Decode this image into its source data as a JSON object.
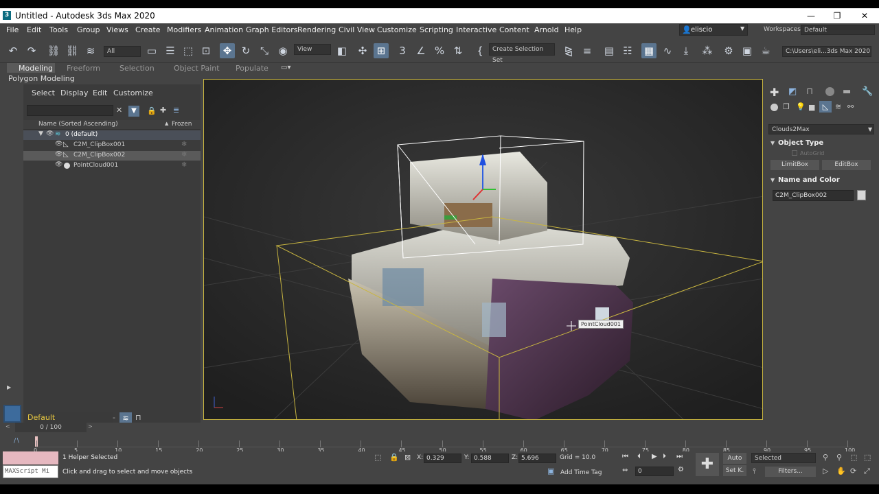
{
  "titlebar": {
    "title": "Untitled - Autodesk 3ds Max 2020",
    "app_icon": "3",
    "minimize": "—",
    "restore": "❐",
    "close": "✕"
  },
  "menus": [
    "File",
    "Edit",
    "Tools",
    "Group",
    "Views",
    "Create",
    "Modifiers",
    "Animation",
    "Graph Editors",
    "Rendering",
    "Civil View",
    "Customize",
    "Scripting",
    "Interactive",
    "Content",
    "Arnold",
    "Help"
  ],
  "user": {
    "name": "eliscio",
    "workspaces_label": "Workspaces:",
    "workspace": "Default"
  },
  "toolbar": {
    "filter": "All",
    "refcoord": "View",
    "selection_set": "Create Selection Set",
    "path": "C:\\Users\\eli...3ds Max 2020"
  },
  "ribbon": {
    "tabs": [
      "Modeling",
      "Freeform",
      "Selection",
      "Object Paint",
      "Populate"
    ],
    "sub": "Polygon Modeling"
  },
  "scene": {
    "menus": [
      "Select",
      "Display",
      "Edit",
      "Customize"
    ],
    "col_name": "Name (Sorted Ascending)",
    "col_frozen": "Frozen",
    "rows": [
      {
        "label": "0 (default)",
        "level": 0
      },
      {
        "label": "C2M_ClipBox001",
        "level": 1
      },
      {
        "label": "C2M_ClipBox002",
        "level": 1
      },
      {
        "label": "PointCloud001",
        "level": 1
      }
    ],
    "layer": "Default"
  },
  "viewport": {
    "tooltip": "PointCloud001"
  },
  "cmd": {
    "dropdown": "Clouds2Max",
    "rollout1": "Object Type",
    "autogrid": "AutoGrid",
    "btn1": "LimitBox",
    "btn2": "EditBox",
    "rollout2": "Name and Color",
    "name": "C2M_ClipBox002",
    "swatch": "#d8d8d8"
  },
  "timeline": {
    "frame": "0 / 100",
    "ticks": [
      "0",
      "5",
      "10",
      "15",
      "20",
      "25",
      "30",
      "35",
      "40",
      "45",
      "50",
      "55",
      "60",
      "65",
      "70",
      "75",
      "80",
      "85",
      "90",
      "95",
      "100"
    ]
  },
  "status": {
    "maxscript": "MAXScript Mi",
    "selected": "1 Helper Selected",
    "prompt": "Click and drag to select and move objects",
    "x_label": "X:",
    "x": "0.329",
    "y_label": "Y:",
    "y": "0.588",
    "z_label": "Z:",
    "z": "5.696",
    "grid": "Grid = 10.0",
    "add_time_tag": "Add Time Tag",
    "frame_field": "0",
    "auto": "Auto",
    "set_key": "Set K.",
    "selected_dd": "Selected",
    "filters": "Filters..."
  },
  "colors": {
    "accent": "#5b7590",
    "bbox": "#c9b640",
    "frame": "#ffffff"
  }
}
